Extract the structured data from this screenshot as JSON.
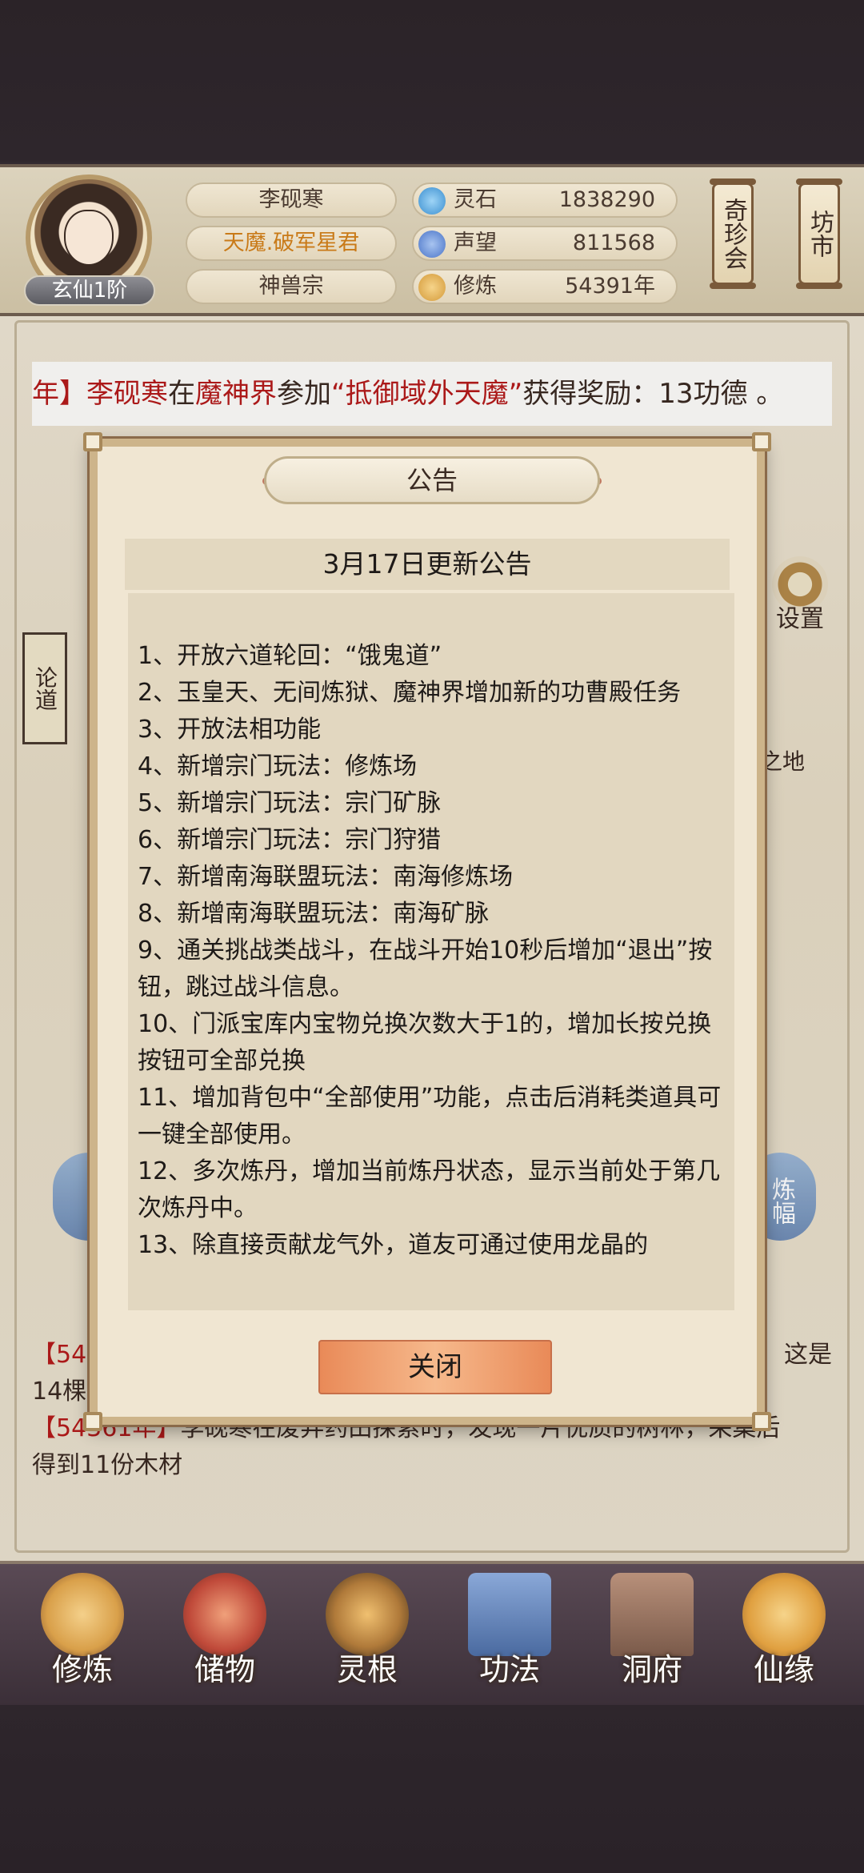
{
  "header": {
    "player_name": "李砚寒",
    "title": "天魔.破军星君",
    "sect": "神兽宗",
    "rank": "玄仙1阶",
    "resources": [
      {
        "label": "灵石",
        "value": "1838290",
        "icon": "spirit-stone-icon",
        "color": "#3b8fd0"
      },
      {
        "label": "声望",
        "value": "811568",
        "icon": "prestige-icon",
        "color": "#4a74c8"
      },
      {
        "label": "修炼",
        "value": "54391年",
        "icon": "cultivation-icon",
        "color": "#d49a3a"
      }
    ],
    "side_buttons": [
      "奇珍会",
      "坊市"
    ]
  },
  "ticker": {
    "prefix": "年】",
    "name": "李砚寒",
    "mid1": "在",
    "place": "魔神界",
    "mid2": "参加",
    "event": "“抵御域外天魔”",
    "suffix": "获得奖励：13功德 。"
  },
  "scene": {
    "side_scroll": "论道",
    "settings_label": "设置",
    "land_label": "之地",
    "orb_label": "炼幅"
  },
  "log": {
    "line1_prefix": "【543",
    "line1_suffix": "这是",
    "line2": "14棵",
    "line3_prefix": "【54361年】",
    "line3_text": "李砚寒在废弃药田探索时，发现一片优质的树林，采集后",
    "line4": "得到11份木材"
  },
  "dialog": {
    "title": "公告",
    "subtitle": "3月17日更新公告",
    "items": [
      "1、开放六道轮回：“饿鬼道”",
      "2、玉皇天、无间炼狱、魔神界增加新的功曹殿任务",
      "3、开放法相功能",
      "4、新增宗门玩法：修炼场",
      "5、新增宗门玩法：宗门矿脉",
      "6、新增宗门玩法：宗门狩猎",
      "7、新增南海联盟玩法：南海修炼场",
      "8、新增南海联盟玩法：南海矿脉",
      "9、通关挑战类战斗，在战斗开始10秒后增加“退出”按钮，跳过战斗信息。",
      "10、门派宝库内宝物兑换次数大于1的，增加长按兑换按钮可全部兑换",
      "11、增加背包中“全部使用”功能，点击后消耗类道具可一键全部使用。",
      "12、多次炼丹，增加当前炼丹状态，显示当前处于第几次炼丹中。",
      "13、除直接贡献龙气外，道友可通过使用龙晶的"
    ],
    "close_label": "关闭"
  },
  "nav": [
    {
      "label": "修炼",
      "icon": "cultivate-icon",
      "color": "#d9a04a"
    },
    {
      "label": "储物",
      "icon": "storage-bag-icon",
      "color": "#c04a3a"
    },
    {
      "label": "灵根",
      "icon": "spirit-root-icon",
      "color": "#b07a3a"
    },
    {
      "label": "功法",
      "icon": "technique-book-icon",
      "color": "#4a6aa0"
    },
    {
      "label": "洞府",
      "icon": "cave-dwelling-icon",
      "color": "#7a5a4a"
    },
    {
      "label": "仙缘",
      "icon": "gourd-icon",
      "color": "#e0a040"
    }
  ]
}
